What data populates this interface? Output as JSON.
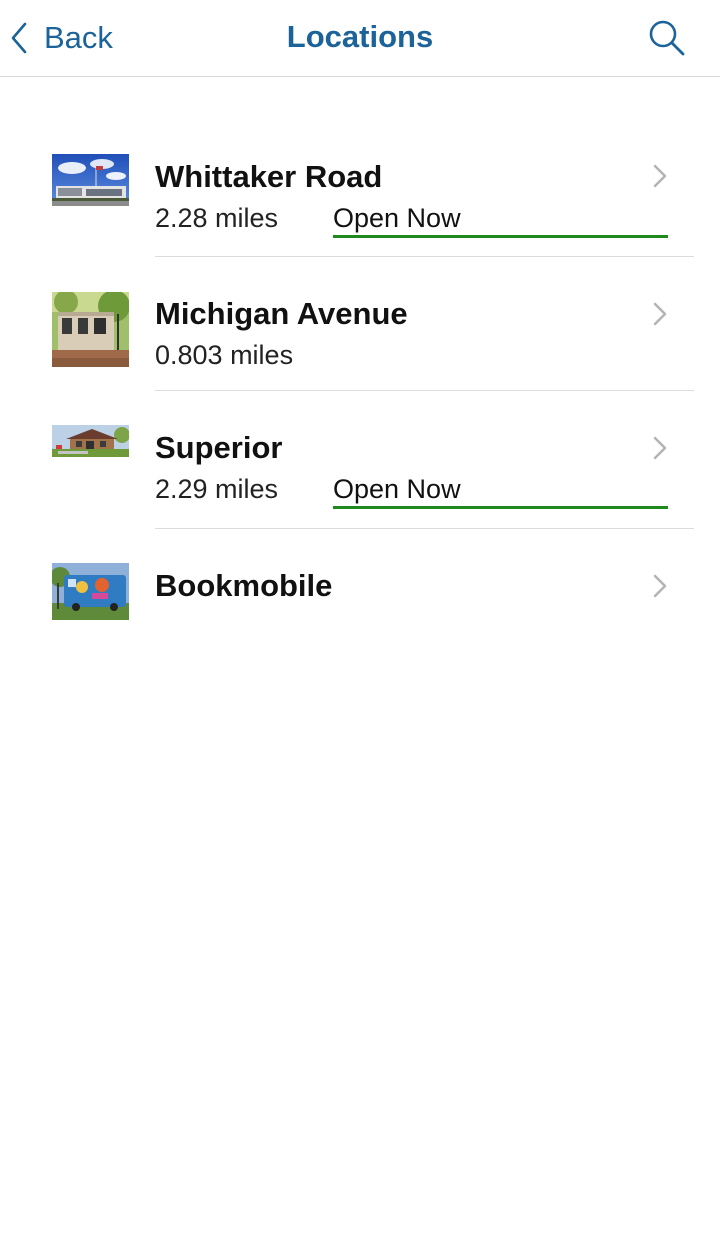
{
  "nav": {
    "back_label": "Back",
    "title": "Locations",
    "accent_color": "#1b6399"
  },
  "locations": [
    {
      "name": "Whittaker Road",
      "distance": "2.28 miles",
      "status": "Open Now",
      "thumbnail": "library-building-photo"
    },
    {
      "name": "Michigan Avenue",
      "distance": "0.803 miles",
      "status": "",
      "thumbnail": "downtown-library-photo"
    },
    {
      "name": "Superior",
      "distance": "2.29 miles",
      "status": "Open Now",
      "thumbnail": "superior-branch-photo"
    },
    {
      "name": "Bookmobile",
      "distance": "",
      "status": "",
      "thumbnail": "bookmobile-photo"
    }
  ],
  "status_color": "#1e8a1e"
}
